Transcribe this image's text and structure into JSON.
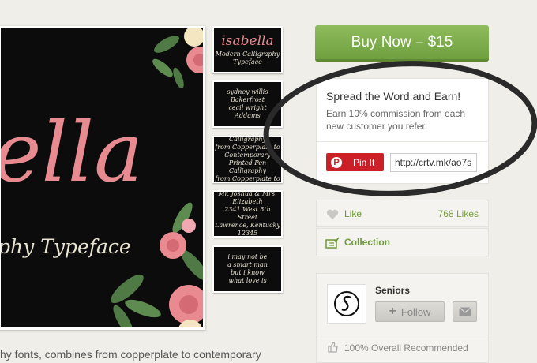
{
  "preview": {
    "title_fragment": "ella",
    "subtitle_fragment": "phy Typeface",
    "caption": "hy fonts, combines from copperplate to contemporary"
  },
  "thumbnails": [
    {
      "title": "isabella",
      "sub": "Modern Calligraphy Typeface"
    },
    {
      "text": "sydney willis\nBakerfrost\ncecil wright\nAddams"
    },
    {
      "text": "Printed Pen Calligraphy\nfrom Copperplate to Contemporary\nPrinted Pen Calligraphy\nfrom Copperplate to Contemporary"
    },
    {
      "text": "Mr. Joshua & Mrs. Elizabeth\n2341 West 5th Street\nLawrence, Kentucky\n12345"
    },
    {
      "text": "i may not be\na smart man\nbut i know\nwhat love is"
    }
  ],
  "buy": {
    "label": "Buy Now",
    "separator": "–",
    "price": "$15"
  },
  "spread": {
    "title": "Spread the Word and Earn!",
    "text": "Earn 10% commission from each new customer you refer.",
    "pin_label": "Pin It",
    "pin_glyph": "P",
    "url": "http://crtv.mk/ao7s"
  },
  "like": {
    "label": "Like",
    "count": "768 Likes",
    "icon": "heart-icon"
  },
  "collection": {
    "label": "Collection",
    "icon": "collection-add-icon"
  },
  "owner": {
    "name": "Seniors",
    "follow_label": "Follow",
    "follow_glyph": "+",
    "recommended": "100% Overall Recommended"
  },
  "colors": {
    "accent_green": "#7aa046",
    "pinterest_red": "#cb2027",
    "title_pink": "#e88b91"
  }
}
